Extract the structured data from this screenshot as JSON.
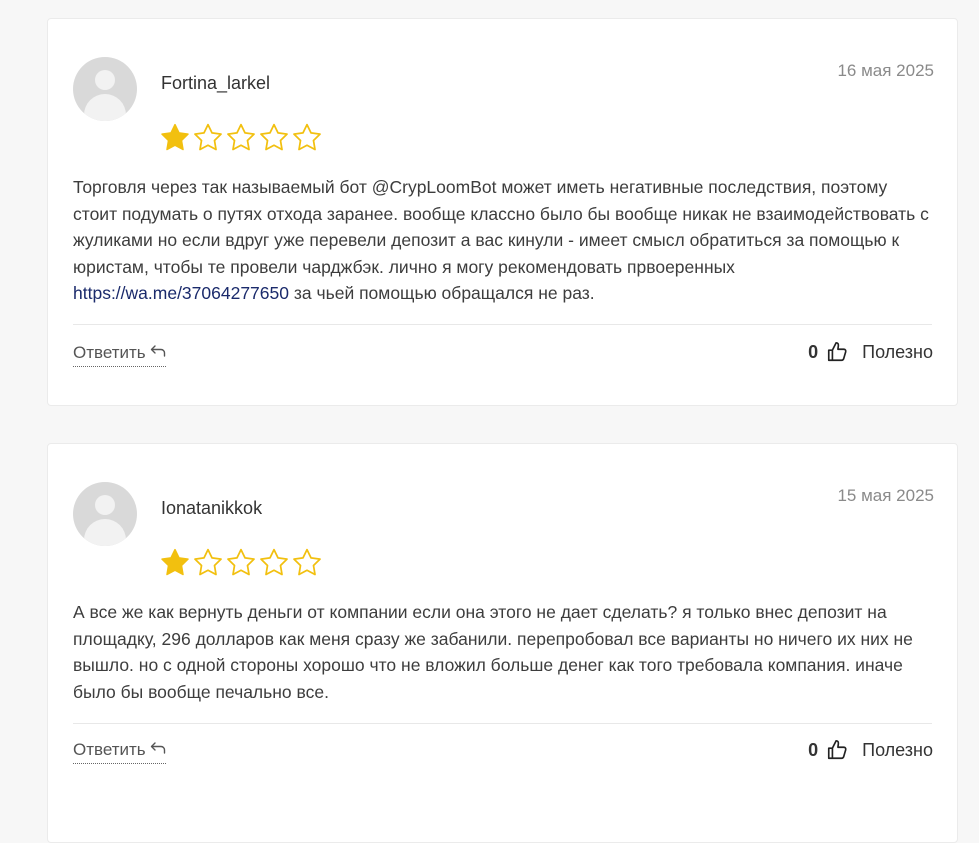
{
  "reviews": [
    {
      "author": "Fortina_larkel",
      "date": "16 мая 2025",
      "rating": 1,
      "max_rating": 5,
      "text_before_link": "Торговля через так называемый бот @CrypLoomBot может иметь негативные последствия, поэтому стоит подумать о путях отхода заранее. вообще классно было бы вообще никак не взаимодействовать с жуликами но если вдруг уже перевели депозит а вас кинули - имеет смысл обратиться за помощью к юристам, чтобы те провели чарджбэк. лично я могу рекомендовать првоеренных ",
      "link_text": "https://wa.me/37064277650",
      "text_after_link": " за чьей помощью обращался не раз.",
      "reply_label": "Ответить",
      "helpful_count": "0",
      "helpful_label": "Полезно"
    },
    {
      "author": "Ionatanikkok",
      "date": "15 мая 2025",
      "rating": 1,
      "max_rating": 5,
      "text_before_link": "А все же как вернуть деньги от компании если она этого не дает сделать? я только внес депозит на площадку, 296 долларов как меня сразу же забанили. перепробовал все варианты но ничего их них не вышло. но с одной стороны хорошо что не вложил больше денег как того требовала компания. иначе было бы вообще печально все.",
      "link_text": "",
      "text_after_link": "",
      "reply_label": "Ответить",
      "helpful_count": "0",
      "helpful_label": "Полезно"
    }
  ],
  "icons": {
    "avatar": "user-avatar-placeholder",
    "star_filled": "star-filled-icon",
    "star_empty": "star-outline-icon",
    "reply": "reply-arrow-icon",
    "thumb": "thumbs-up-icon"
  },
  "colors": {
    "star": "#f2c00f",
    "link": "#1a2a6b",
    "date": "#8a8a8a"
  }
}
